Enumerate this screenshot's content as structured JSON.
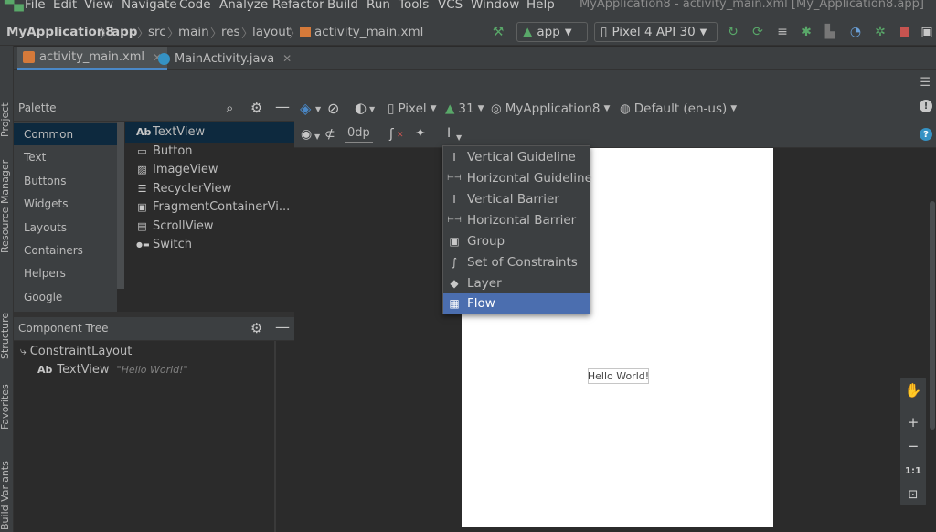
{
  "menu": {
    "items": [
      "File",
      "Edit",
      "View",
      "Navigate",
      "Code",
      "Analyze",
      "Refactor",
      "Build",
      "Run",
      "Tools",
      "VCS",
      "Window",
      "Help"
    ],
    "window_title": "MyApplication8 - activity_main.xml [My_Application8.app]"
  },
  "nav": {
    "crumbs": [
      "MyApplication8",
      "app",
      "src",
      "main",
      "res",
      "layout",
      "activity_main.xml"
    ],
    "run_config": "app",
    "device": "Pixel 4 API 30"
  },
  "side": {
    "project": "Project",
    "resource_manager": "Resource Manager",
    "structure": "Structure",
    "favorites": "Favorites",
    "build_variants": "Build Variants"
  },
  "tabs": [
    {
      "label": "activity_main.xml"
    },
    {
      "label": "MainActivity.java"
    }
  ],
  "palette": {
    "title": "Palette",
    "categories": [
      "Common",
      "Text",
      "Buttons",
      "Widgets",
      "Layouts",
      "Containers",
      "Helpers",
      "Google"
    ],
    "items": [
      {
        "icon": "Ab",
        "label": "TextView"
      },
      {
        "icon": "▭",
        "label": "Button"
      },
      {
        "icon": "▨",
        "label": "ImageView"
      },
      {
        "icon": "☰",
        "label": "RecyclerView"
      },
      {
        "icon": "▣",
        "label": "FragmentContainerVi..."
      },
      {
        "icon": "▤",
        "label": "ScrollView"
      },
      {
        "icon": "●▬",
        "label": "Switch"
      }
    ]
  },
  "component_tree": {
    "title": "Component Tree",
    "root": "ConstraintLayout",
    "child_icon": "Ab",
    "child": "TextView",
    "child_text": "\"Hello World!\""
  },
  "design_toolbar": {
    "device": "Pixel",
    "api": "31",
    "theme": "MyApplication8",
    "locale": "Default (en-us)",
    "margin": "0dp"
  },
  "dropdown": {
    "items": [
      {
        "label": "Vertical Guideline",
        "icon": "I"
      },
      {
        "label": "Horizontal Guideline",
        "icon": "⊢⊣"
      },
      {
        "label": "Vertical Barrier",
        "icon": "I"
      },
      {
        "label": "Horizontal Barrier",
        "icon": "⊢⊣"
      },
      {
        "label": "Group",
        "icon": "▣"
      },
      {
        "label": "Set of Constraints",
        "icon": "∫"
      },
      {
        "label": "Layer",
        "icon": "◆"
      },
      {
        "label": "Flow",
        "icon": "▦"
      }
    ],
    "selected": "Flow"
  },
  "canvas": {
    "hello_text": "Hello World!"
  },
  "zoom": {
    "zoom_in": "+",
    "zoom_out": "−",
    "actual": "1:1"
  },
  "colors": {
    "accent": "#4a88c7",
    "selection": "#4b6eaf",
    "run_green": "#59a869"
  }
}
